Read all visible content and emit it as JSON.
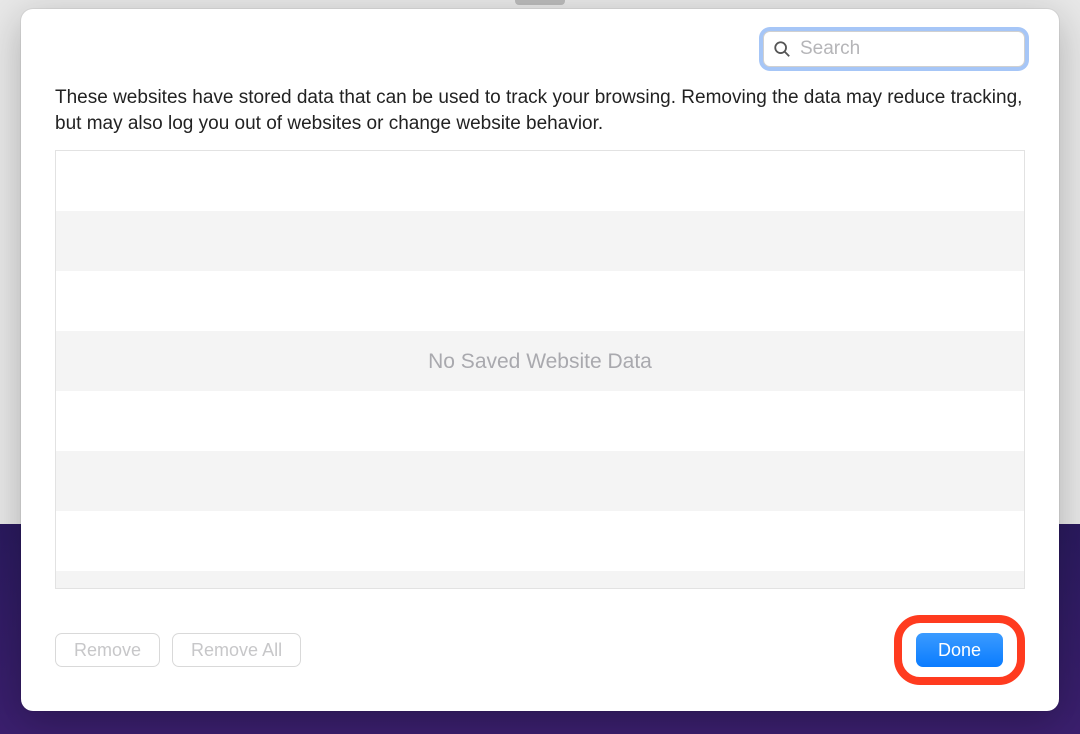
{
  "search": {
    "placeholder": "Search",
    "value": ""
  },
  "description": "These websites have stored data that can be used to track your browsing. Removing the data may reduce tracking, but may also log you out of websites or change website behavior.",
  "list": {
    "empty_message": "No Saved Website Data"
  },
  "buttons": {
    "remove": "Remove",
    "remove_all": "Remove All",
    "done": "Done"
  }
}
